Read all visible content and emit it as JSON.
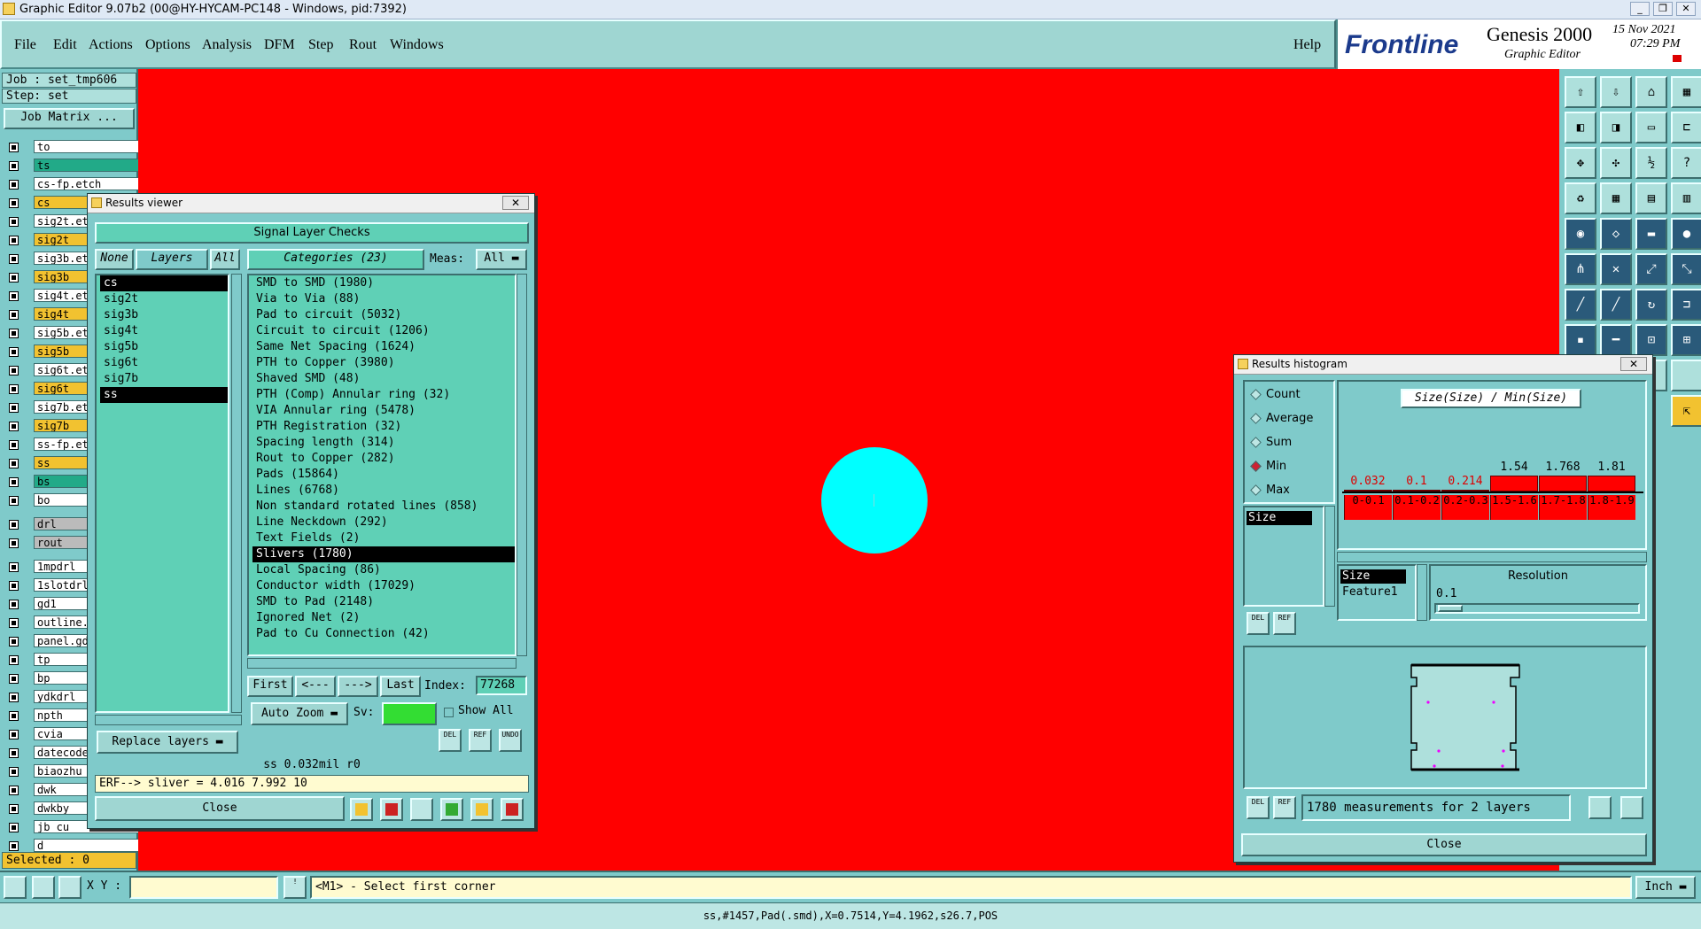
{
  "window": {
    "title": "Graphic Editor 9.07b2 (00@HY-HYCAM-PC148 - Windows, pid:7392)"
  },
  "menu": [
    "File",
    "Edit",
    "Actions",
    "Options",
    "Analysis",
    "DFM",
    "Step",
    "Rout",
    "Windows"
  ],
  "help": "Help",
  "brand": {
    "name": "Frontline",
    "product": "Genesis 2000",
    "sub": "Graphic Editor",
    "date": "15 Nov 2021",
    "time": "07:29 PM"
  },
  "job": {
    "job": "Job : set_tmp606",
    "step": "Step: set",
    "matrix_btn": "Job Matrix ..."
  },
  "layers": [
    {
      "name": "to",
      "color": "#ffffff"
    },
    {
      "name": "ts",
      "color": "#22aa88"
    },
    {
      "name": "cs-fp.etch",
      "color": "#ffffff"
    },
    {
      "name": "cs",
      "color": "#f2c230"
    },
    {
      "name": "sig2t.et",
      "color": "#ffffff"
    },
    {
      "name": "sig2t",
      "color": "#f2c230"
    },
    {
      "name": "sig3b.et",
      "color": "#ffffff"
    },
    {
      "name": "sig3b",
      "color": "#f2c230"
    },
    {
      "name": "sig4t.et",
      "color": "#ffffff"
    },
    {
      "name": "sig4t",
      "color": "#f2c230"
    },
    {
      "name": "sig5b.et",
      "color": "#ffffff"
    },
    {
      "name": "sig5b",
      "color": "#f2c230"
    },
    {
      "name": "sig6t.et",
      "color": "#ffffff"
    },
    {
      "name": "sig6t",
      "color": "#f2c230"
    },
    {
      "name": "sig7b.et",
      "color": "#ffffff"
    },
    {
      "name": "sig7b",
      "color": "#f2c230"
    },
    {
      "name": "ss-fp.et",
      "color": "#ffffff"
    },
    {
      "name": "ss",
      "color": "#f2c230"
    },
    {
      "name": "bs",
      "color": "#22aa88"
    },
    {
      "name": "bo",
      "color": "#ffffff"
    },
    {
      "name": "drl",
      "color": "#bbbbbb"
    },
    {
      "name": "rout",
      "color": "#bbbbbb"
    },
    {
      "name": "1mpdrl",
      "color": "#ffffff"
    },
    {
      "name": "1slotdrl",
      "color": "#ffffff"
    },
    {
      "name": "gd1",
      "color": "#ffffff"
    },
    {
      "name": "outline.",
      "color": "#ffffff"
    },
    {
      "name": "panel.gd",
      "color": "#ffffff"
    },
    {
      "name": "tp",
      "color": "#ffffff"
    },
    {
      "name": "bp",
      "color": "#ffffff"
    },
    {
      "name": "ydkdrl",
      "color": "#ffffff"
    },
    {
      "name": "npth",
      "color": "#ffffff"
    },
    {
      "name": "cvia",
      "color": "#ffffff"
    },
    {
      "name": "datecode",
      "color": "#ffffff"
    },
    {
      "name": "biaozhu",
      "color": "#ffffff"
    },
    {
      "name": "dwk",
      "color": "#ffffff"
    },
    {
      "name": "dwkby",
      "color": "#ffffff"
    },
    {
      "name": "jb_cu",
      "color": "#ffffff"
    },
    {
      "name": "d",
      "color": "#ffffff"
    }
  ],
  "selected": "Selected : 0",
  "results_viewer": {
    "title": "Results viewer",
    "header": "Signal Layer Checks",
    "none": "None",
    "layers": "Layers",
    "all": "All",
    "categories_label": "Categories (23)",
    "meas_label": "Meas:",
    "meas_value": "All",
    "layer_list": [
      "cs",
      "sig2t",
      "sig3b",
      "sig4t",
      "sig5b",
      "sig6t",
      "sig7b",
      "ss"
    ],
    "categories": [
      "SMD to SMD (1980)",
      "Via to Via (88)",
      "Pad to circuit (5032)",
      "Circuit to circuit (1206)",
      "Same Net Spacing (1624)",
      "PTH to Copper (3980)",
      "Shaved SMD (48)",
      "PTH (Comp) Annular ring (32)",
      "VIA Annular ring (5478)",
      "PTH Registration (32)",
      "Spacing length (314)",
      "Rout to Copper (282)",
      "Pads (15864)",
      "Lines (6768)",
      "Non standard rotated lines (858)",
      "Line Neckdown (292)",
      "Text Fields (2)",
      "Slivers (1780)",
      "Local Spacing (86)",
      "Conductor width (17029)",
      "SMD to Pad (2148)",
      "Ignored Net (2)",
      "Pad to Cu Connection (42)"
    ],
    "first": "First",
    "prev": "<---",
    "next": "--->",
    "last": "Last",
    "index_label": "Index:",
    "index_value": "77268",
    "autozoom": "Auto Zoom",
    "sv": "Sv:",
    "showall": "Show All",
    "replace_layers": "Replace layers",
    "del": "DEL",
    "ref": "REF",
    "undo": "UNDO",
    "status": "ss 0.032mil  r0",
    "erf": "ERF--> sliver = 4.016 7.992 10",
    "close": "Close"
  },
  "histogram": {
    "title": "Results histogram",
    "modes": [
      "Count",
      "Average",
      "Sum",
      "Min",
      "Max"
    ],
    "selected_mode": "Min",
    "chart_title": "Size(Size) / Min(Size)",
    "size_item": "Size",
    "values": [
      "0.032",
      "0.1",
      "0.214",
      "1.54",
      "1.768",
      "1.81"
    ],
    "bins": [
      "0-0.1",
      "0.1-0.2",
      "0.2-0.3",
      "1.5-1.6",
      "1.7-1.8",
      "1.8-1.9"
    ],
    "axis_list": [
      "Size",
      "Feature1"
    ],
    "resolution_label": "Resolution",
    "resolution_value": "0.1",
    "del": "DEL",
    "ref": "REF",
    "summary": "1780 measurements for 2 layers",
    "close": "Close"
  },
  "statusbar": {
    "xy_label": "X Y :",
    "xy_value": "",
    "prompt": "<M1> - Select first corner",
    "units": "Inch"
  },
  "bottom_info": "ss,#1457,Pad(.smd),X=0.7514,Y=4.1962,s26.7,POS"
}
